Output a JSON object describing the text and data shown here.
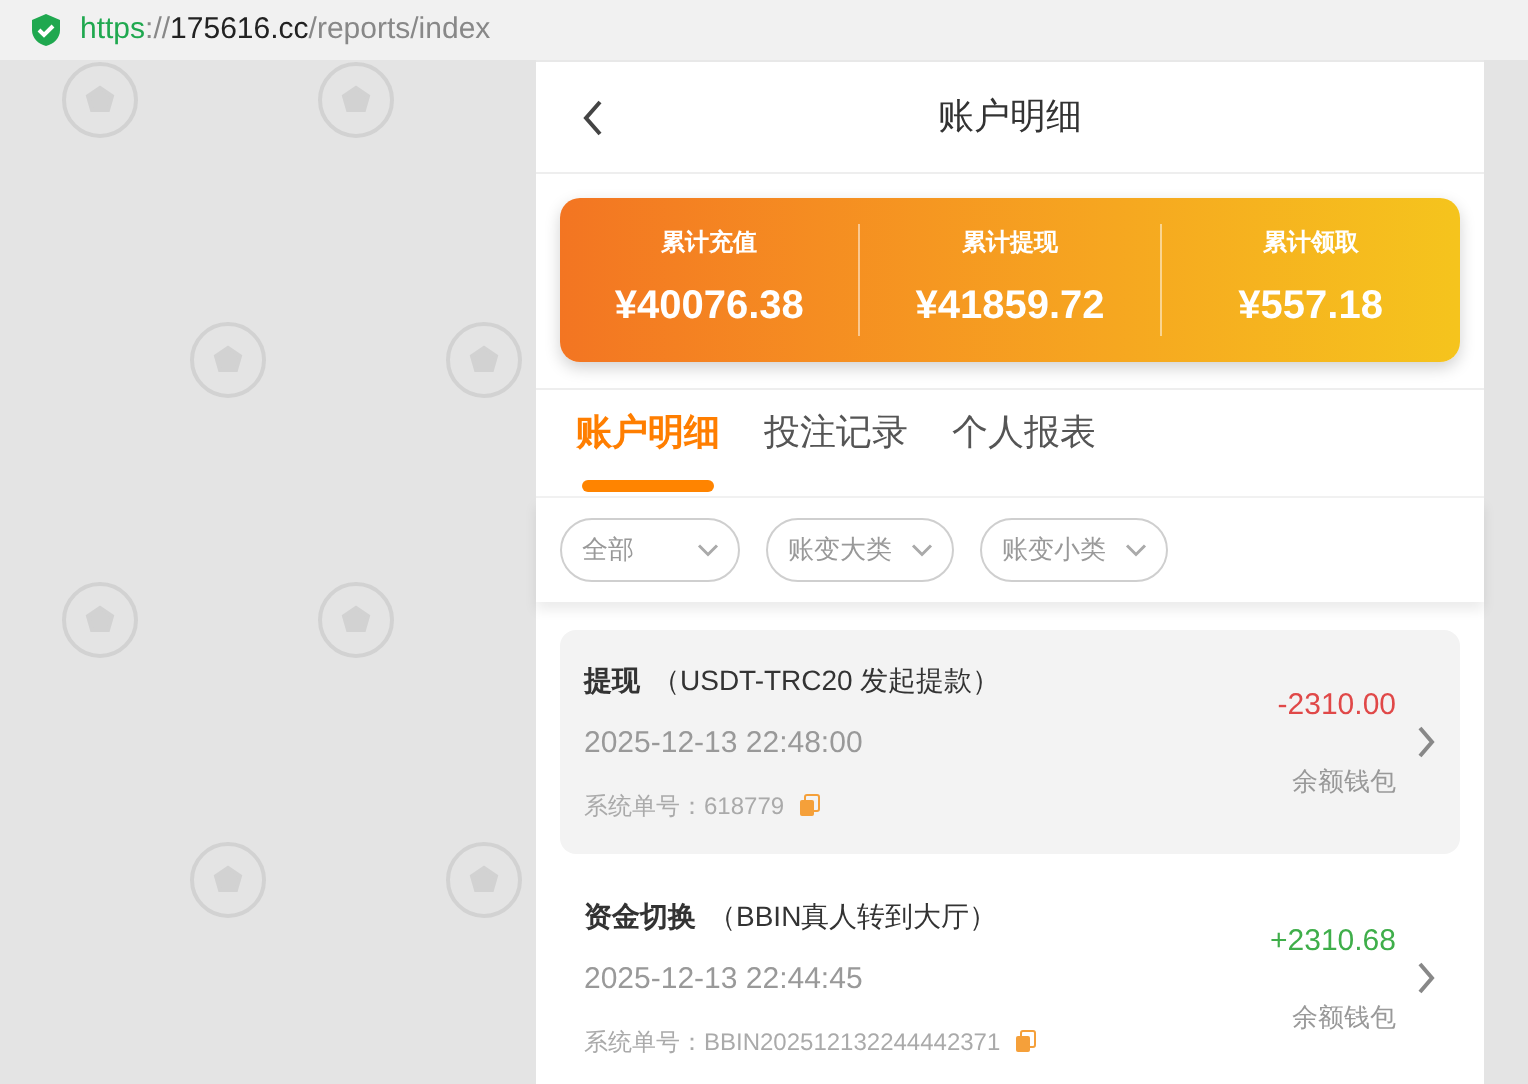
{
  "address_bar": {
    "scheme": "https",
    "separator": "://",
    "host": "175616.cc",
    "path": "/reports/index"
  },
  "header": {
    "title": "账户明细"
  },
  "summary": [
    {
      "label": "累计充值",
      "value": "¥40076.38"
    },
    {
      "label": "累计提现",
      "value": "¥41859.72"
    },
    {
      "label": "累计领取",
      "value": "¥557.18"
    }
  ],
  "tabs": [
    {
      "label": "账户明细",
      "selected": true
    },
    {
      "label": "投注记录",
      "selected": false
    },
    {
      "label": "个人报表",
      "selected": false
    }
  ],
  "filters": [
    {
      "label": "全部"
    },
    {
      "label": "账变大类"
    },
    {
      "label": "账变小类"
    }
  ],
  "records": [
    {
      "type": "提现",
      "detail": "（USDT-TRC20 发起提款）",
      "time": "2025-12-13 22:48:00",
      "order_no": "系统单号：618779",
      "amount": "-2310.00",
      "kind": "debit",
      "wallet": "余额钱包",
      "selected": true
    },
    {
      "type": "资金切换",
      "detail": "（BBIN真人转到大厅）",
      "time": "2025-12-13 22:44:45",
      "order_no": "系统单号：BBIN202512132244442371",
      "amount": "+2310.68",
      "kind": "credit",
      "wallet": "余额钱包",
      "selected": false
    }
  ]
}
